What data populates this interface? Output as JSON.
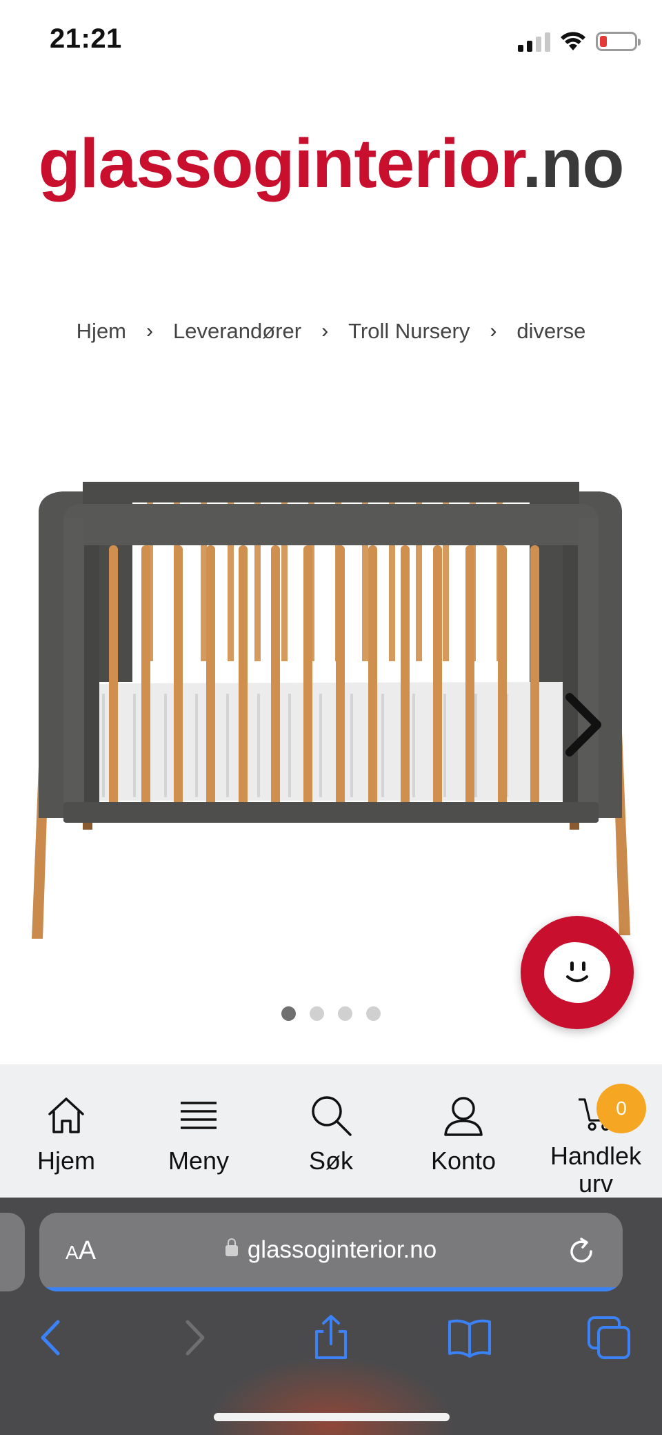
{
  "status_bar": {
    "time": "21:21",
    "battery_color": "#e53935"
  },
  "logo": {
    "main": "glassoginterior",
    "tld": ".no",
    "brand_color": "#c8102e"
  },
  "breadcrumb": {
    "items": [
      "Hjem",
      "Leverandører",
      "Troll Nursery",
      "diverse"
    ],
    "separator_icon": "chevron-right-icon"
  },
  "product": {
    "image_alt": "crib",
    "slide_count": 4,
    "active_slide": 1,
    "next_icon": "chevron-right-icon"
  },
  "chat": {
    "icon": "chat-face-icon",
    "color": "#c8102e"
  },
  "site_nav": {
    "items": [
      {
        "label": "Hjem",
        "icon": "home-icon"
      },
      {
        "label": "Meny",
        "icon": "menu-icon"
      },
      {
        "label": "Søk",
        "icon": "search-icon"
      },
      {
        "label": "Konto",
        "icon": "user-icon"
      },
      {
        "label": "Handlekurv",
        "icon": "cart-icon"
      }
    ],
    "cart_count": "0",
    "badge_color": "#f5a623"
  },
  "browser": {
    "aa_label_small": "A",
    "aa_label_large": "A",
    "url": "glassoginterior.no",
    "load_progress": 1.0,
    "toolbar": {
      "back_icon": "back-chevron-icon",
      "forward_icon": "forward-chevron-icon",
      "share_icon": "share-icon",
      "bookmarks_icon": "book-icon",
      "tabs_icon": "tabs-icon"
    }
  }
}
